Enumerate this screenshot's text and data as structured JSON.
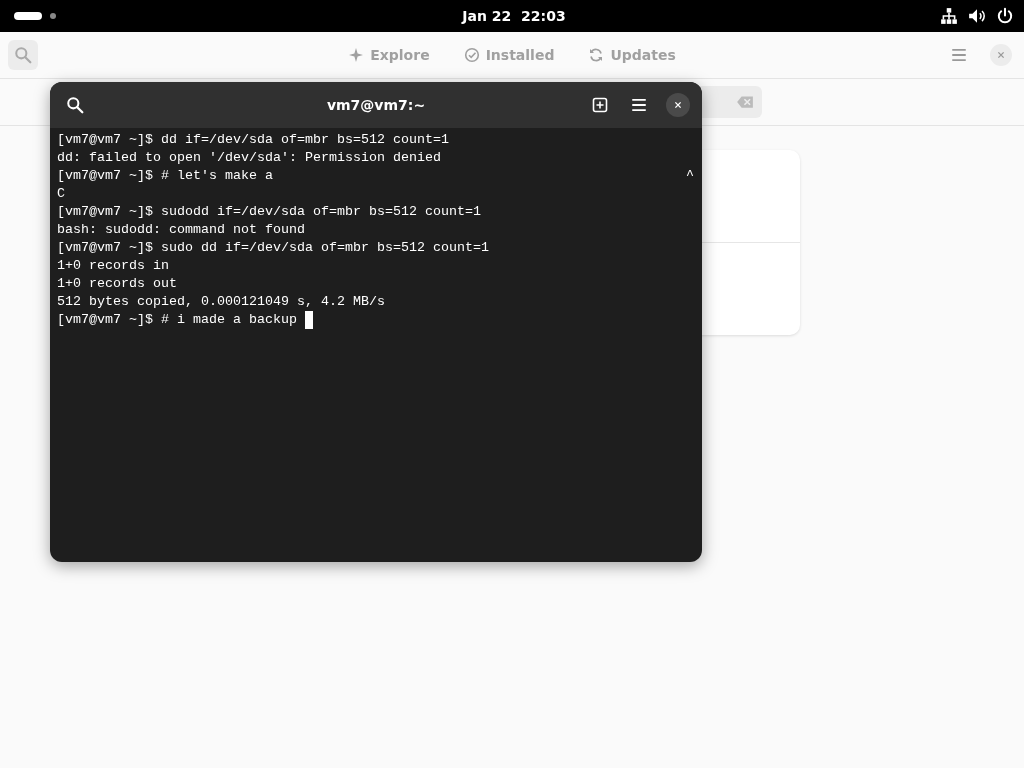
{
  "top_bar": {
    "clock": "Jan 22  22:03"
  },
  "app": {
    "tabs": [
      {
        "label": "Explore",
        "kind": "explore",
        "selected": false
      },
      {
        "label": "Installed",
        "kind": "installed",
        "selected": false
      },
      {
        "label": "Updates",
        "kind": "updates",
        "selected": false
      }
    ]
  },
  "terminal": {
    "title": "vm7@vm7:~",
    "lines": [
      {
        "text": "[vm7@vm7 ~]$ dd if=/dev/sda of=mbr bs=512 count=1"
      },
      {
        "text": "dd: failed to open '/dev/sda': Permission denied"
      },
      {
        "text": "[vm7@vm7 ~]$ # let's make a",
        "mark": "^"
      },
      {
        "text": "C"
      },
      {
        "text": "[vm7@vm7 ~]$ sudodd if=/dev/sda of=mbr bs=512 count=1"
      },
      {
        "text": "bash: sudodd: command not found"
      },
      {
        "text": "[vm7@vm7 ~]$ sudo dd if=/dev/sda of=mbr bs=512 count=1"
      },
      {
        "text": "1+0 records in"
      },
      {
        "text": "1+0 records out"
      },
      {
        "text": "512 bytes copied, 0.000121049 s, 4.2 MB/s"
      },
      {
        "text": "[vm7@vm7 ~]$ # i made a backup ",
        "cursor": true
      }
    ]
  }
}
